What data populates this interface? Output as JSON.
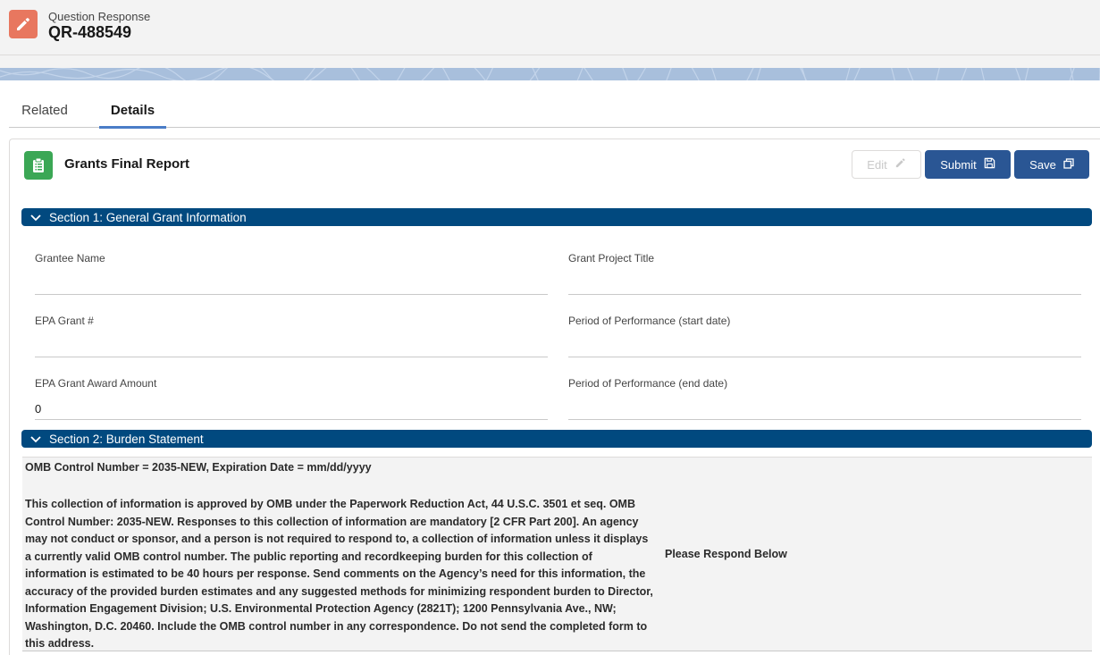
{
  "header": {
    "object_type": "Question Response",
    "record_name": "QR-488549",
    "icon": "pencil-icon",
    "icon_color": "#e8775f"
  },
  "tabs": [
    {
      "label": "Related",
      "active": false
    },
    {
      "label": "Details",
      "active": true
    }
  ],
  "card": {
    "title": "Grants Final Report",
    "icon": "clipboard-icon",
    "icon_color": "#3ba755",
    "buttons": {
      "edit": {
        "label": "Edit",
        "icon": "pencil-icon",
        "disabled": true
      },
      "submit": {
        "label": "Submit",
        "icon": "floppy-disk-icon"
      },
      "save": {
        "label": "Save",
        "icon": "copy-icon"
      }
    }
  },
  "sections": [
    {
      "title": "Section 1: General Grant Information",
      "expanded": true,
      "fields": [
        {
          "label": "Grantee Name",
          "value": ""
        },
        {
          "label": "Grant Project Title",
          "value": ""
        },
        {
          "label": "EPA Grant #",
          "value": ""
        },
        {
          "label": "Period of Performance (start date)",
          "value": ""
        },
        {
          "label": "EPA Grant Award Amount",
          "value": "0"
        },
        {
          "label": "Period of Performance (end date)",
          "value": ""
        }
      ]
    },
    {
      "title": "Section 2: Burden Statement",
      "expanded": true,
      "omb_line": "OMB Control Number = 2035-NEW, Expiration Date = mm/dd/yyyy",
      "statement": "This collection of information is approved by OMB under the Paperwork Reduction Act, 44 U.S.C. 3501 et seq. OMB Control Number: 2035-NEW. Responses to this collection of information are mandatory [2 CFR Part 200]. An agency may not conduct or sponsor, and a person is not required to respond to, a collection of information unless it displays a currently valid OMB control number. The public reporting and recordkeeping burden for this collection of information is estimated to be 40 hours per response. Send comments on the Agency’s need for this information, the accuracy of the provided burden estimates and any suggested methods for minimizing respondent burden to Director, Information Engagement Division; U.S. Environmental Protection Agency (2821T); 1200 Pennsylvania Ave., NW; Washington, D.C. 20460. Include the OMB control number in any correspondence. Do not send the completed form to this address.",
      "respond_label": "Please Respond Below"
    }
  ],
  "colors": {
    "section_header_bg": "#01497f",
    "primary_button_bg": "#2a5694",
    "active_tab_underline": "#4a7dc7"
  }
}
